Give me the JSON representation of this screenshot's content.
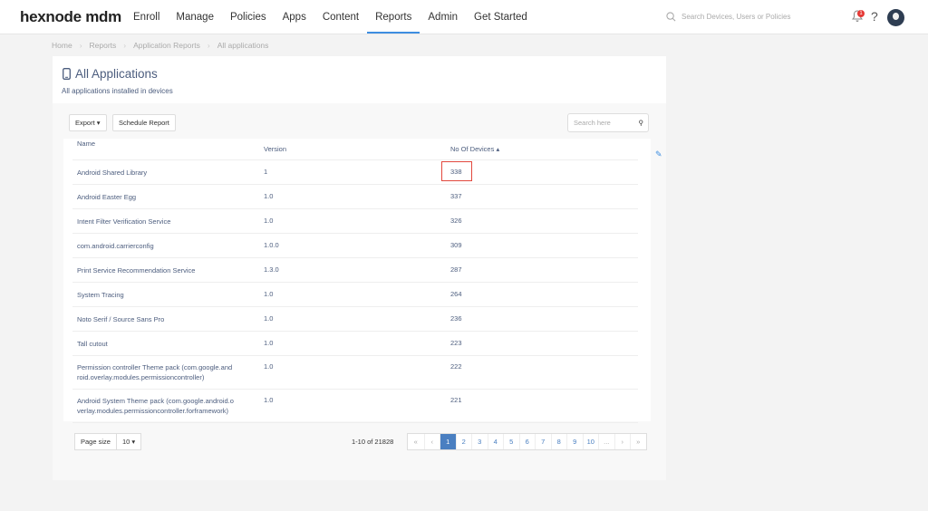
{
  "nav": {
    "logo": "hexnode mdm",
    "items": [
      "Enroll",
      "Manage",
      "Policies",
      "Apps",
      "Content",
      "Reports",
      "Admin",
      "Get Started"
    ],
    "active": "Reports",
    "search_placeholder": "Search Devices, Users or Policies",
    "notification_count": "1",
    "help": "?"
  },
  "breadcrumb": [
    "Home",
    "Reports",
    "Application Reports",
    "All applications"
  ],
  "page": {
    "title": "All Applications",
    "subtitle": "All applications installed in devices"
  },
  "toolbar": {
    "export": "Export",
    "schedule": "Schedule Report",
    "search_placeholder": "Search here"
  },
  "table": {
    "headers": [
      "Name",
      "Version",
      "No Of Devices"
    ],
    "sort": "ascending-icon",
    "rows": [
      {
        "name": "Android Shared Library",
        "version": "1",
        "devices": "338"
      },
      {
        "name": "Android Easter Egg",
        "version": "1.0",
        "devices": "337"
      },
      {
        "name": "Intent Filter Verification Service",
        "version": "1.0",
        "devices": "326"
      },
      {
        "name": "com.android.carrierconfig",
        "version": "1.0.0",
        "devices": "309"
      },
      {
        "name": "Print Service Recommendation Service",
        "version": "1.3.0",
        "devices": "287"
      },
      {
        "name": "System Tracing",
        "version": "1.0",
        "devices": "264"
      },
      {
        "name": "Noto Serif / Source Sans Pro",
        "version": "1.0",
        "devices": "236"
      },
      {
        "name": "Tall cutout",
        "version": "1.0",
        "devices": "223"
      },
      {
        "name": "Permission controller Theme pack (com.google.and roid.overlay.modules.permissioncontroller)",
        "version": "1.0",
        "devices": "222"
      },
      {
        "name": "Android System Theme pack (com.google.android.o verlay.modules.permissioncontroller.forframework)",
        "version": "1.0",
        "devices": "221"
      }
    ]
  },
  "footer": {
    "page_size_label": "Page size",
    "page_size": "10",
    "count": "1-10 of 21828",
    "pages": [
      "«",
      "‹",
      "1",
      "2",
      "3",
      "4",
      "5",
      "6",
      "7",
      "8",
      "9",
      "10",
      "...",
      "›",
      "»"
    ],
    "current": "1"
  },
  "colors": {
    "accent": "#4a7fc1",
    "highlight": "#e2483d"
  }
}
